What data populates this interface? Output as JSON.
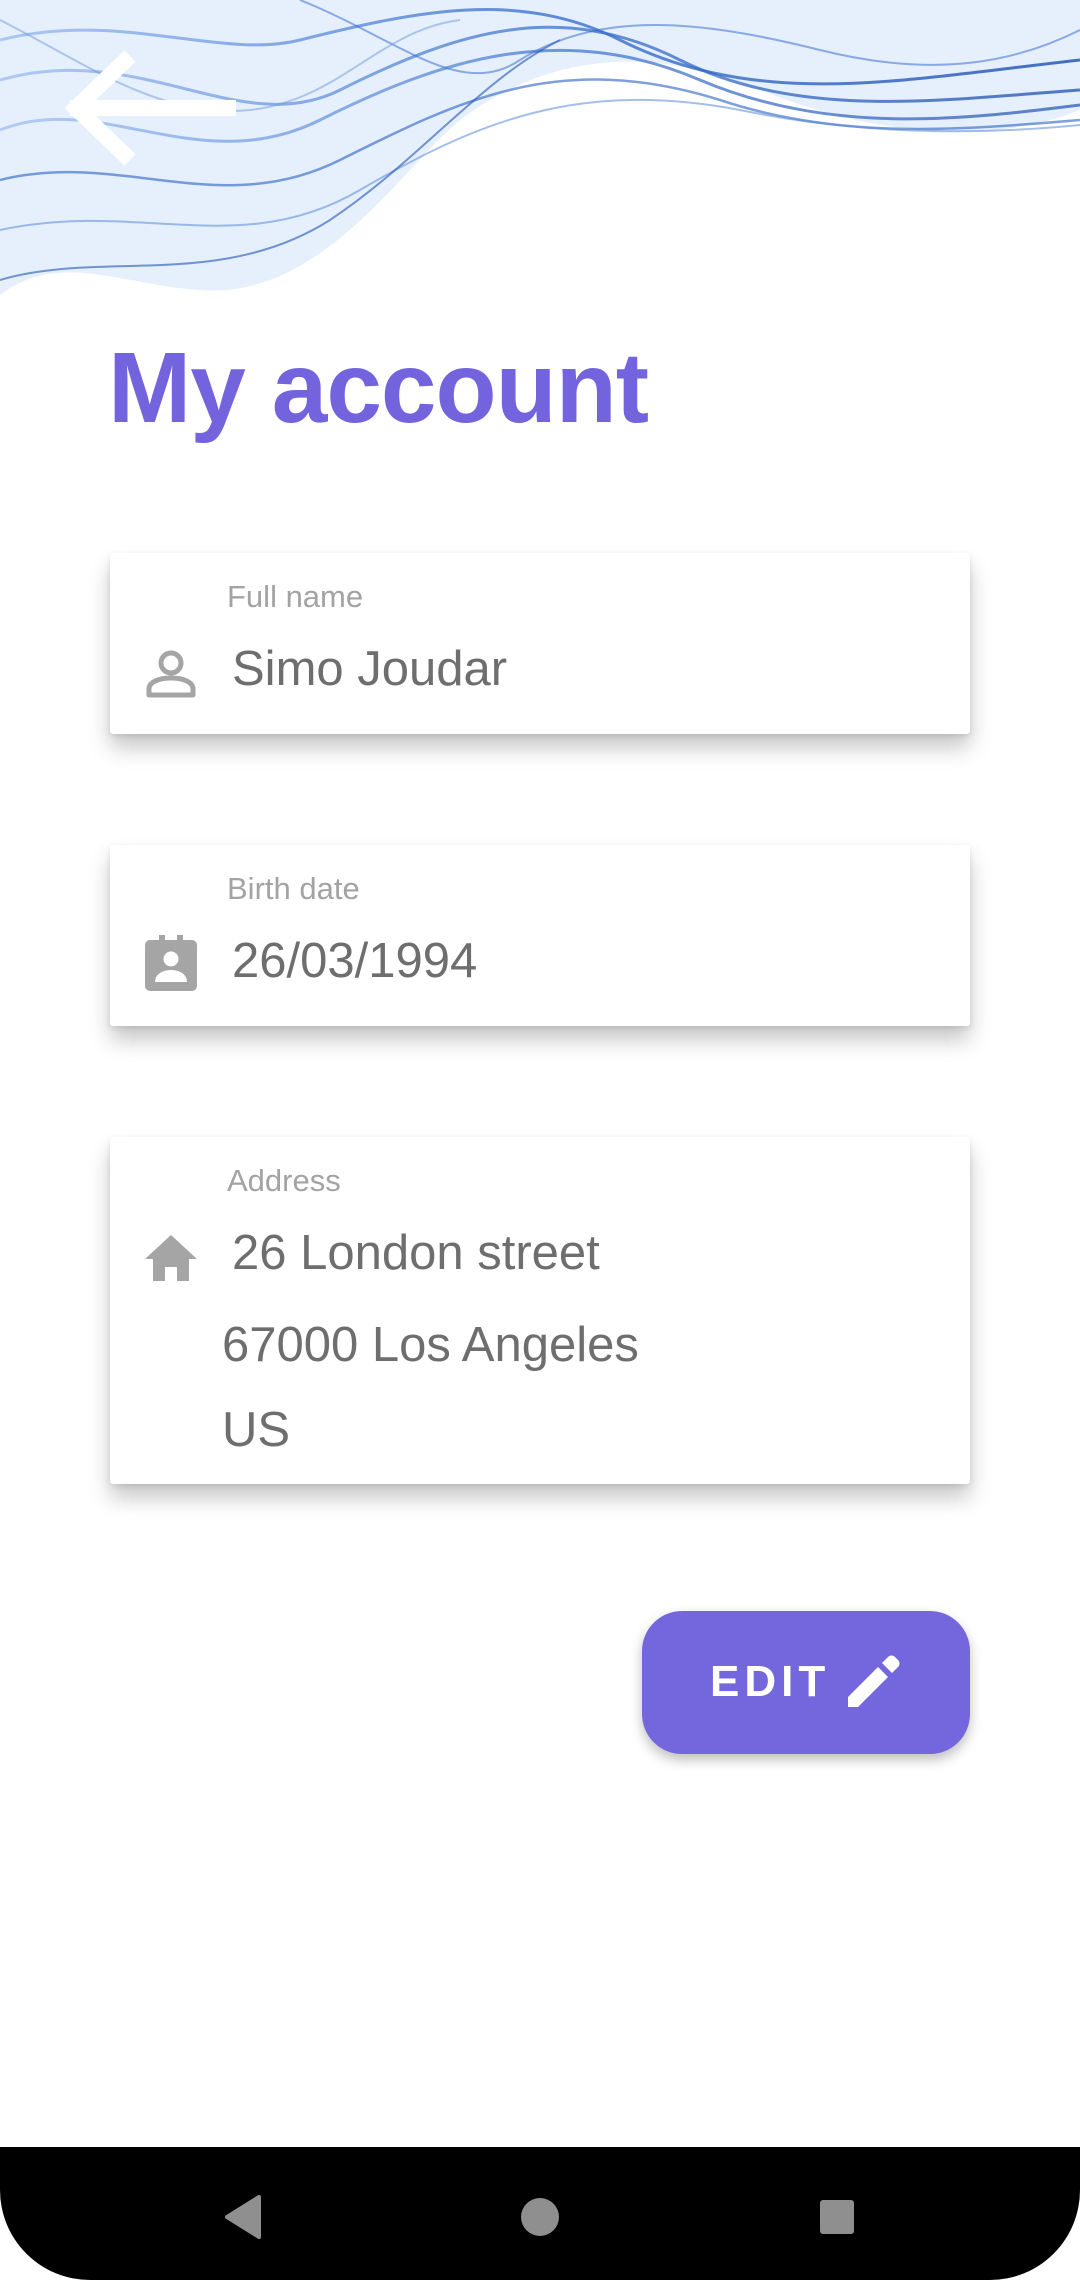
{
  "header": {
    "back_icon": "arrow-left-icon",
    "title": "My account"
  },
  "fields": {
    "full_name": {
      "label": "Full name",
      "value": "Simo Joudar",
      "icon": "person-icon"
    },
    "birth_date": {
      "label": "Birth date",
      "value": "26/03/1994",
      "icon": "contact-calendar-icon"
    },
    "address": {
      "label": "Address",
      "line1": "26 London street",
      "line2": "67000 Los Angeles",
      "line3": "US",
      "icon": "home-icon"
    }
  },
  "edit_button": {
    "label": "EDIT",
    "icon": "pencil-icon"
  },
  "navigation": {
    "back_icon": "nav-back-icon",
    "home_icon": "nav-home-icon",
    "recents_icon": "nav-recents-icon"
  },
  "colors": {
    "accent": "#7364dd",
    "wave_blue": "#2f66c8",
    "label_gray": "#a3a3a3",
    "value_gray": "#6e6e6e"
  }
}
